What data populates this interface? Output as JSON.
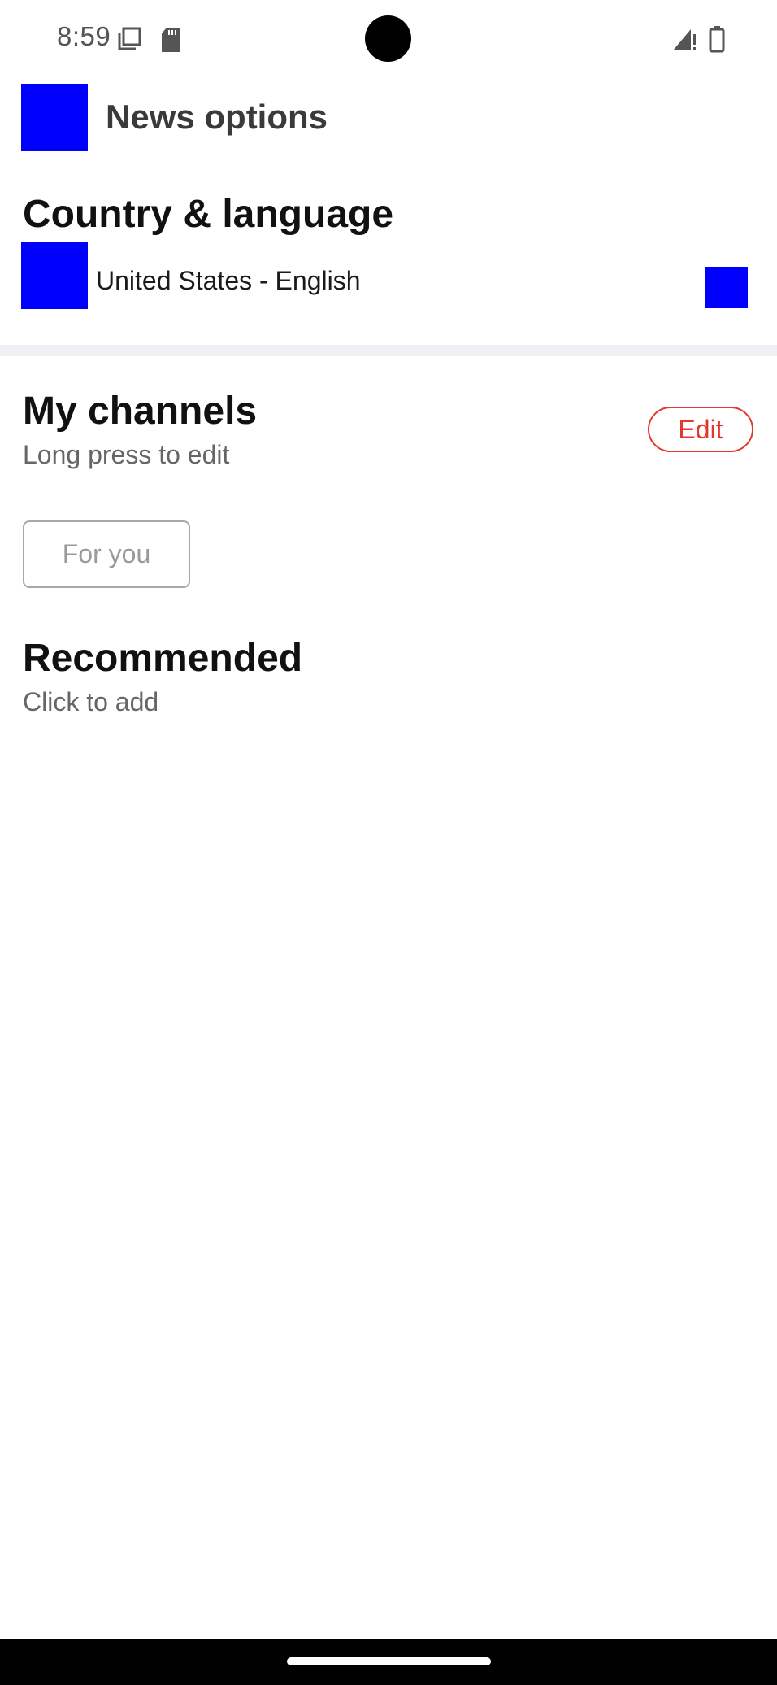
{
  "status_bar": {
    "time": "8:59",
    "icons": [
      "screenshot-icon",
      "sd-card-icon",
      "signal-icon",
      "battery-icon"
    ]
  },
  "app_bar": {
    "title": "News options",
    "back_icon": "back-icon"
  },
  "country_section": {
    "heading": "Country & language",
    "selected": "United States - English",
    "flag_icon": "flag-icon",
    "chevron_icon": "chevron-right-icon"
  },
  "channels_section": {
    "heading": "My channels",
    "hint": "Long press to edit",
    "edit_label": "Edit",
    "channels": [
      "For you"
    ]
  },
  "recommended_section": {
    "heading": "Recommended",
    "hint": "Click to add"
  },
  "colors": {
    "accent": "#e5382d",
    "placeholder_blue": "#0000ff",
    "divider": "#eff1f4"
  }
}
